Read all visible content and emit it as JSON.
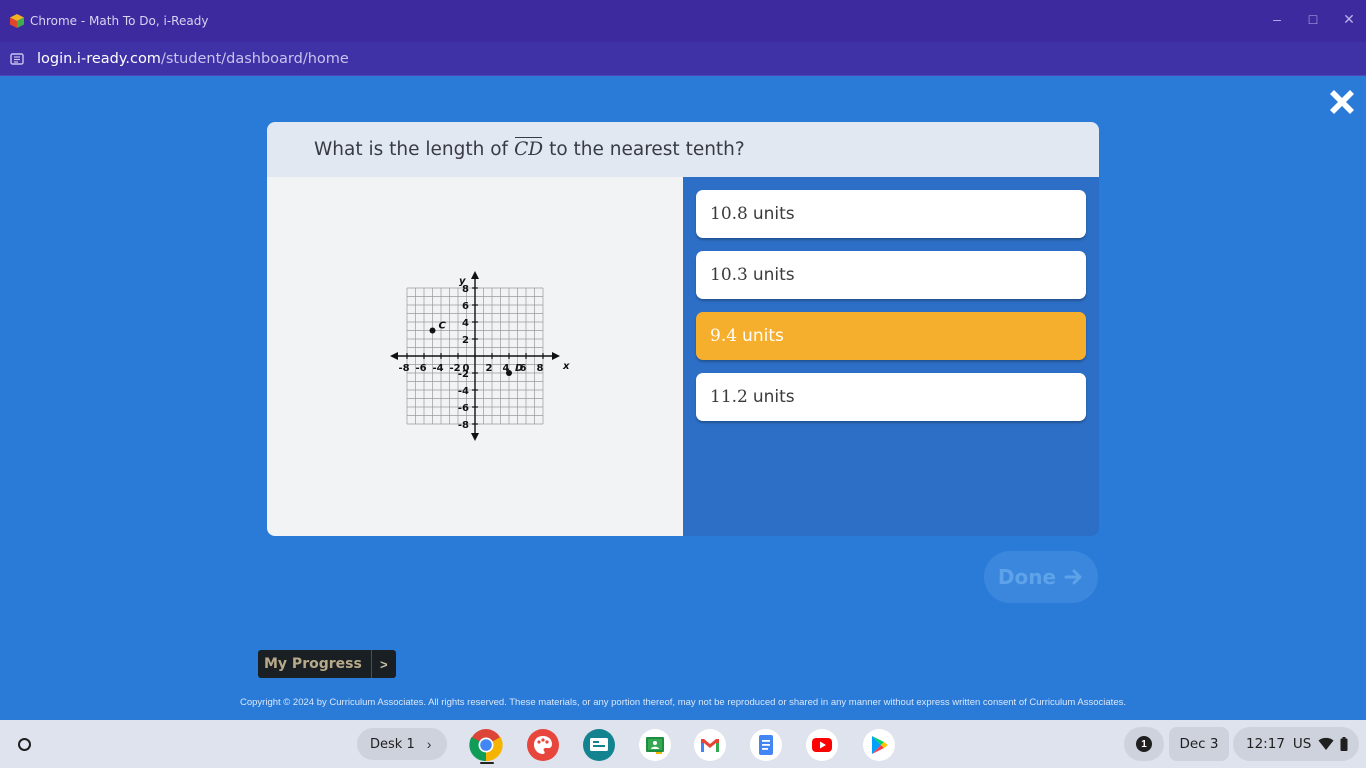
{
  "window": {
    "title": "Chrome - Math To Do, i-Ready",
    "url_host": "login.i-ready.com",
    "url_path": "/student/dashboard/home"
  },
  "question": {
    "prefix": "What is the length of",
    "segment": "CD",
    "suffix": "to the nearest tenth?"
  },
  "graph": {
    "x_label": "x",
    "y_label": "y",
    "x_range": [
      -8,
      8
    ],
    "y_range": [
      -8,
      8
    ],
    "x_tick_labels": [
      "-8",
      "-6",
      "-4",
      "-2",
      "0",
      "2",
      "4",
      "6",
      "8"
    ],
    "y_tick_labels": [
      "8",
      "6",
      "4",
      "2",
      "-2",
      "-4",
      "-6",
      "-8"
    ],
    "points": [
      {
        "label": "C",
        "x": -5,
        "y": 3
      },
      {
        "label": "D",
        "x": 4,
        "y": -2
      }
    ]
  },
  "answers": [
    {
      "value": "10.8",
      "unit": "units",
      "selected": false
    },
    {
      "value": "10.3",
      "unit": "units",
      "selected": false
    },
    {
      "value": "9.4",
      "unit": "units",
      "selected": true
    },
    {
      "value": "11.2",
      "unit": "units",
      "selected": false
    }
  ],
  "done_label": "Done",
  "my_progress_label": "My Progress",
  "my_progress_chevron": ">",
  "copyright": "Copyright © 2024 by Curriculum Associates. All rights reserved. These materials, or any portion thereof, may not be reproduced or shared in any manner without express written consent of Curriculum Associates.",
  "shelf": {
    "desk_label": "Desk 1",
    "desk_arrow": "›",
    "apps": [
      "chrome",
      "canvas",
      "classroom-slides",
      "google-classroom",
      "gmail",
      "google-docs",
      "youtube",
      "play-store"
    ],
    "notification_count": "1",
    "date": "Dec 3",
    "time": "12:17",
    "language": "US"
  },
  "colors": {
    "background": "#2a7bd8",
    "title_bar": "#3d2a9e",
    "selected_answer": "#f6ae2d",
    "answers_pane": "#2d6fc6"
  }
}
